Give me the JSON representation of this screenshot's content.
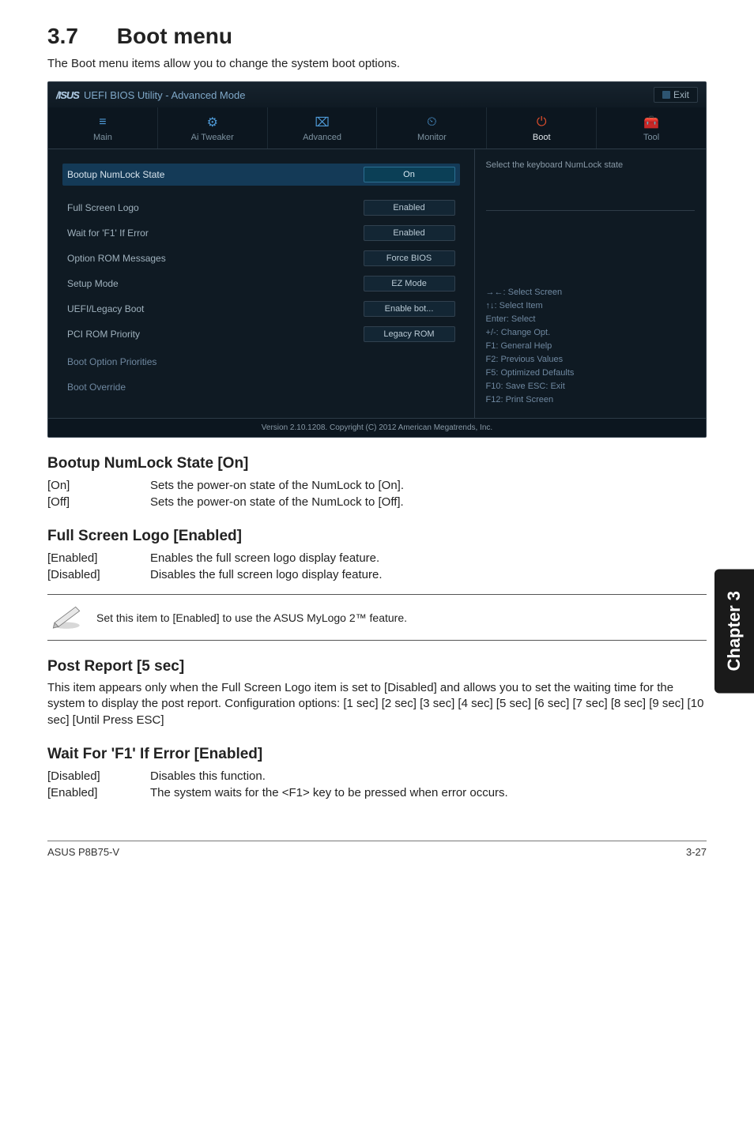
{
  "section": {
    "number": "3.7",
    "title": "Boot menu"
  },
  "intro": "The Boot menu items allow you to change the system boot options.",
  "bios": {
    "brand": "/ISUS",
    "title": "UEFI BIOS Utility - Advanced Mode",
    "exit_label": "Exit",
    "tabs": [
      {
        "icon": "list-icon",
        "glyph": "≡",
        "label": "Main"
      },
      {
        "icon": "tweaker-icon",
        "glyph": "⚙",
        "label": "Ai Tweaker"
      },
      {
        "icon": "advanced-icon",
        "glyph": "⌧",
        "label": "Advanced"
      },
      {
        "icon": "monitor-icon",
        "glyph": "⏲",
        "label": "Monitor"
      },
      {
        "icon": "power-icon",
        "glyph": "⏻",
        "label": "Boot",
        "active": true
      },
      {
        "icon": "tool-icon",
        "glyph": "🧰",
        "label": "Tool"
      }
    ],
    "rows": [
      {
        "label": "Bootup NumLock State",
        "value": "On",
        "selected": true
      },
      {
        "label": "Full Screen Logo",
        "value": "Enabled"
      },
      {
        "label": "Wait for 'F1' If Error",
        "value": "Enabled"
      },
      {
        "label": "Option ROM Messages",
        "value": "Force BIOS"
      },
      {
        "label": "Setup Mode",
        "value": "EZ Mode"
      },
      {
        "label": "UEFI/Legacy Boot",
        "value": "Enable bot..."
      },
      {
        "label": "PCI ROM Priority",
        "value": "Legacy ROM"
      }
    ],
    "sections": [
      {
        "label": "Boot Option Priorities"
      },
      {
        "label": "Boot Override"
      }
    ],
    "help_text": "Select the keyboard NumLock state",
    "shortcuts": [
      "→←: Select Screen",
      "↑↓: Select Item",
      "Enter: Select",
      "+/-: Change Opt.",
      "F1: General Help",
      "F2: Previous Values",
      "F5: Optimized Defaults",
      "F10: Save   ESC: Exit",
      "F12: Print Screen"
    ],
    "footer": "Version 2.10.1208.  Copyright (C) 2012 American Megatrends, Inc."
  },
  "subsections": {
    "numlock": {
      "title": "Bootup NumLock State [On]",
      "rows": [
        {
          "k": "[On]",
          "v": "Sets the power-on state of the NumLock to [On]."
        },
        {
          "k": "[Off]",
          "v": "Sets the power-on state of the NumLock to [Off]."
        }
      ]
    },
    "fslogo": {
      "title": "Full Screen Logo [Enabled]",
      "rows": [
        {
          "k": "[Enabled]",
          "v": "Enables the full screen logo display feature."
        },
        {
          "k": "[Disabled]",
          "v": "Disables the full screen logo display feature."
        }
      ],
      "note": "Set this item to [Enabled] to use the ASUS MyLogo 2™ feature."
    },
    "postreport": {
      "title": "Post Report [5 sec]",
      "body": "This item appears only when the Full Screen Logo item is set to [Disabled] and allows you to set the waiting time for the system to display the post report. Configuration options: [1 sec] [2 sec] [3 sec] [4 sec] [5 sec] [6 sec] [7 sec] [8 sec] [9 sec] [10 sec] [Until Press ESC]"
    },
    "waitf1": {
      "title": "Wait For 'F1' If Error [Enabled]",
      "rows": [
        {
          "k": "[Disabled]",
          "v": "Disables this function."
        },
        {
          "k": "[Enabled]",
          "v": "The system waits for the <F1> key to be pressed when error occurs."
        }
      ]
    }
  },
  "side_tab": "Chapter 3",
  "footer": {
    "left": "ASUS P8B75-V",
    "right": "3-27"
  }
}
